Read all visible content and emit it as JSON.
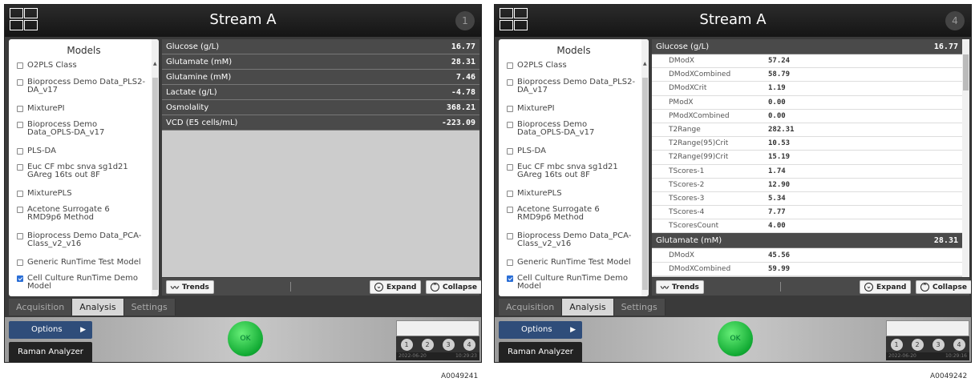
{
  "left": {
    "title": "Stream A",
    "badge": "1",
    "models_title": "Models",
    "models": [
      {
        "label": "O2PLS Class",
        "checked": false
      },
      {
        "label": "Bioprocess Demo Data_PLS2-DA_v17",
        "checked": false
      },
      {
        "label": "MixturePI",
        "checked": false
      },
      {
        "label": "Bioprocess Demo Data_OPLS-DA_v17",
        "checked": false
      },
      {
        "label": "PLS-DA",
        "checked": false
      },
      {
        "label": "Euc CF mbc snva sg1d21 GAreg 16ts out 8F",
        "checked": false
      },
      {
        "label": "MixturePLS",
        "checked": false
      },
      {
        "label": "Acetone Surrogate 6 RMD9p6 Method",
        "checked": false
      },
      {
        "label": "Bioprocess Demo Data_PCA-Class_v2_v16",
        "checked": false
      },
      {
        "label": "Generic RunTime Test Model",
        "checked": false
      },
      {
        "label": "Cell Culture RunTime Demo Model",
        "checked": true
      }
    ],
    "tabs": [
      "Acquisition",
      "Analysis",
      "Settings"
    ],
    "active_tab": "Analysis",
    "rows": [
      {
        "name": "Glucose (g/L)",
        "value": "16.77"
      },
      {
        "name": "Glutamate (mM)",
        "value": "28.31"
      },
      {
        "name": "Glutamine (mM)",
        "value": "7.46"
      },
      {
        "name": "Lactate (g/L)",
        "value": "-4.78"
      },
      {
        "name": "Osmolality",
        "value": "368.21"
      },
      {
        "name": "VCD (E5 cells/mL)",
        "value": "-223.09"
      }
    ],
    "trends_label": "Trends",
    "expand_label": "Expand",
    "collapse_label": "Collapse",
    "options_label": "Options",
    "raman_label": "Raman Analyzer",
    "ok_label": "OK",
    "indicators": [
      "1",
      "2",
      "3",
      "4"
    ],
    "date": "2022-06-20",
    "time": "10:29:23",
    "code": "A0049241"
  },
  "right": {
    "title": "Stream A",
    "badge": "4",
    "models_title": "Models",
    "models": [
      {
        "label": "O2PLS Class",
        "checked": false
      },
      {
        "label": "Bioprocess Demo Data_PLS2-DA_v17",
        "checked": false
      },
      {
        "label": "MixturePI",
        "checked": false
      },
      {
        "label": "Bioprocess Demo Data_OPLS-DA_v17",
        "checked": false
      },
      {
        "label": "PLS-DA",
        "checked": false
      },
      {
        "label": "Euc CF mbc snva sg1d21 GAreg 16ts out 8F",
        "checked": false
      },
      {
        "label": "MixturePLS",
        "checked": false
      },
      {
        "label": "Acetone Surrogate 6 RMD9p6 Method",
        "checked": false
      },
      {
        "label": "Bioprocess Demo Data_PCA-Class_v2_v16",
        "checked": false
      },
      {
        "label": "Generic RunTime Test Model",
        "checked": false
      },
      {
        "label": "Cell Culture RunTime Demo Model",
        "checked": true
      }
    ],
    "tabs": [
      "Acquisition",
      "Analysis",
      "Settings"
    ],
    "active_tab": "Analysis",
    "glucose": {
      "name": "Glucose (g/L)",
      "value": "16.77"
    },
    "glucose_details": [
      {
        "name": "DModX",
        "value": "57.24"
      },
      {
        "name": "DModXCombined",
        "value": "58.79"
      },
      {
        "name": "DModXCrit",
        "value": "1.19"
      },
      {
        "name": "PModX",
        "value": "0.00"
      },
      {
        "name": "PModXCombined",
        "value": "0.00"
      },
      {
        "name": "T2Range",
        "value": "282.31"
      },
      {
        "name": "T2Range(95)Crit",
        "value": "10.53"
      },
      {
        "name": "T2Range(99)Crit",
        "value": "15.19"
      },
      {
        "name": "TScores-1",
        "value": "1.74"
      },
      {
        "name": "TScores-2",
        "value": "12.90"
      },
      {
        "name": "TScores-3",
        "value": "5.34"
      },
      {
        "name": "TScores-4",
        "value": "7.77"
      },
      {
        "name": "TScoresCount",
        "value": "4.00"
      }
    ],
    "glutamate": {
      "name": "Glutamate (mM)",
      "value": "28.31"
    },
    "glutamate_details": [
      {
        "name": "DModX",
        "value": "45.56"
      },
      {
        "name": "DModXCombined",
        "value": "59.99"
      }
    ],
    "trends_label": "Trends",
    "expand_label": "Expand",
    "collapse_label": "Collapse",
    "options_label": "Options",
    "raman_label": "Raman Analyzer",
    "ok_label": "OK",
    "indicators": [
      "1",
      "2",
      "3",
      "4"
    ],
    "date": "2022-06-20",
    "time": "10:29:16",
    "code": "A0049242"
  }
}
